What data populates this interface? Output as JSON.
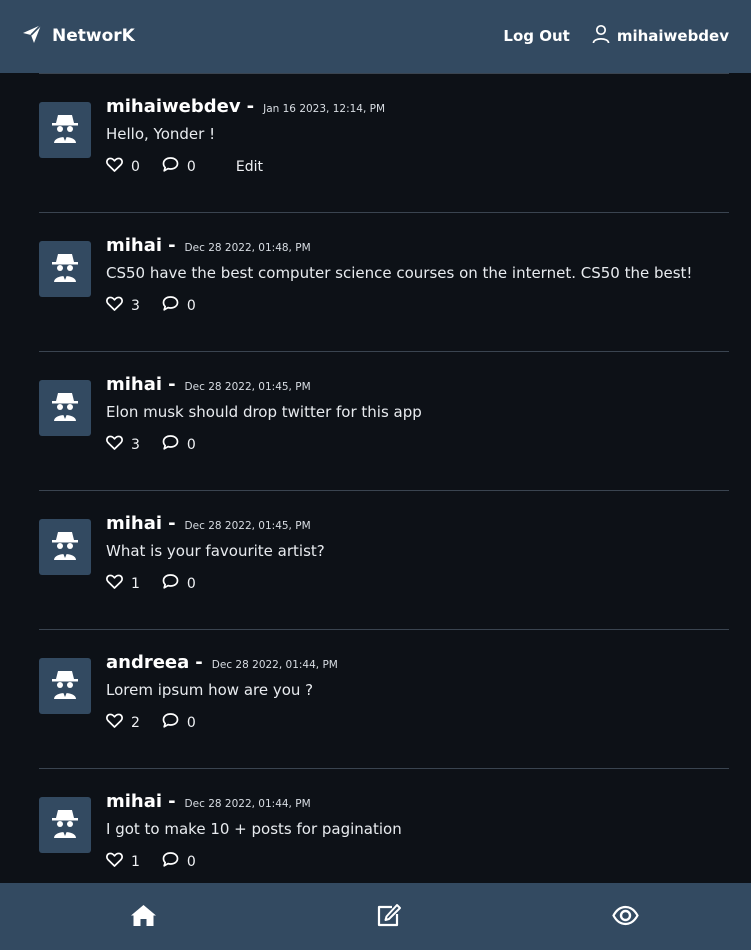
{
  "header": {
    "brand": "NetworK",
    "brand_icon": "paper-plane-icon",
    "logout_label": "Log Out",
    "username": "mihaiwebdev",
    "user_icon": "user-icon",
    "background": "#334a61"
  },
  "posts": [
    {
      "author": "mihaiwebdev",
      "dash": "-",
      "time": "Jan 16 2023, 12:14, PM",
      "body": "Hello, Yonder !",
      "likes": "0",
      "comments": "0",
      "edit_label": "Edit"
    },
    {
      "author": "mihai",
      "dash": "-",
      "time": "Dec 28 2022, 01:48, PM",
      "body": "CS50 have the best computer science courses on the internet. CS50 the best!",
      "likes": "3",
      "comments": "0"
    },
    {
      "author": "mihai",
      "dash": "-",
      "time": "Dec 28 2022, 01:45, PM",
      "body": "Elon musk should drop twitter for this app",
      "likes": "3",
      "comments": "0"
    },
    {
      "author": "mihai",
      "dash": "-",
      "time": "Dec 28 2022, 01:45, PM",
      "body": "What is your favourite artist?",
      "likes": "1",
      "comments": "0"
    },
    {
      "author": "andreea",
      "dash": "-",
      "time": "Dec 28 2022, 01:44, PM",
      "body": "Lorem ipsum how are you ?",
      "likes": "2",
      "comments": "0"
    },
    {
      "author": "mihai",
      "dash": "-",
      "time": "Dec 28 2022, 01:44, PM",
      "body": "I got to make 10 + posts for pagination",
      "likes": "1",
      "comments": "0"
    }
  ],
  "bottom_nav": {
    "items": [
      {
        "icon": "home-icon"
      },
      {
        "icon": "edit-icon"
      },
      {
        "icon": "eye-icon"
      }
    ]
  },
  "colors": {
    "page_bg": "#0d1117",
    "bar_bg": "#334a61",
    "divider": "#3a4450"
  }
}
